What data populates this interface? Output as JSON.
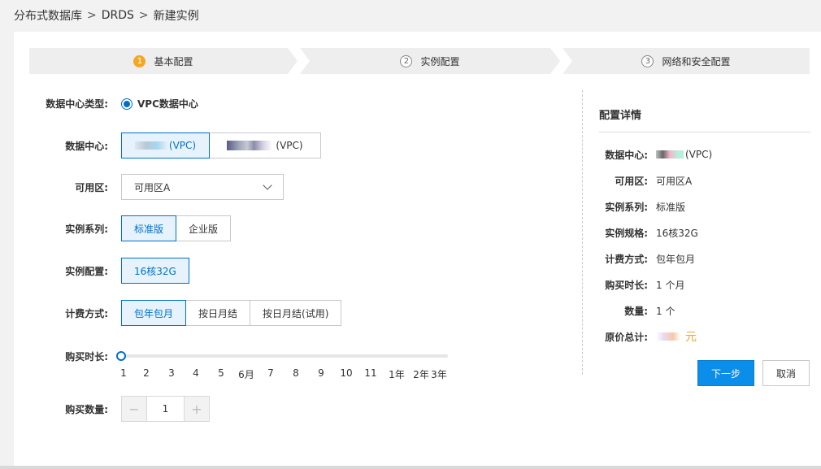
{
  "breadcrumb": {
    "items": [
      "分布式数据库",
      "DRDS",
      "新建实例"
    ],
    "separator": ">"
  },
  "steps": [
    {
      "num": "1",
      "label": "基本配置"
    },
    {
      "num": "2",
      "label": "实例配置"
    },
    {
      "num": "3",
      "label": "网络和安全配置"
    }
  ],
  "form": {
    "datacenter_type": {
      "label": "数据中心类型:",
      "value": "VPC数据中心"
    },
    "datacenter": {
      "label": "数据中心:",
      "options": [
        "(VPC)",
        "(VPC)"
      ]
    },
    "zone": {
      "label": "可用区:",
      "value": "可用区A"
    },
    "series": {
      "label": "实例系列:",
      "options": [
        "标准版",
        "企业版"
      ]
    },
    "config": {
      "label": "实例配置:",
      "options": [
        "16核32G"
      ]
    },
    "billing": {
      "label": "计费方式:",
      "options": [
        "包年包月",
        "按日月结",
        "按日月结(试用)"
      ]
    },
    "duration": {
      "label": "购买时长:",
      "ticks": [
        "1",
        "2",
        "3",
        "4",
        "5",
        "6月",
        "7",
        "8",
        "9",
        "10",
        "11",
        "1年",
        "2年",
        "3年"
      ],
      "selected_index": 0
    },
    "quantity": {
      "label": "购买数量:",
      "value": "1",
      "minus": "−",
      "plus": "+"
    }
  },
  "summary": {
    "title": "配置详情",
    "rows": [
      {
        "k": "数据中心:",
        "v": "(VPC)"
      },
      {
        "k": "可用区:",
        "v": "可用区A"
      },
      {
        "k": "实例系列:",
        "v": "标准版"
      },
      {
        "k": "实例规格:",
        "v": "16核32G"
      },
      {
        "k": "计费方式:",
        "v": "包年包月"
      },
      {
        "k": "购买时长:",
        "v": "1 个月"
      },
      {
        "k": "数量:",
        "v": "1 个"
      },
      {
        "k": "原价总计:",
        "v": "元"
      }
    ]
  },
  "actions": {
    "next": "下一步",
    "cancel": "取消"
  },
  "colors": {
    "accent": "#0070cc",
    "primary_button": "#0a8ee9",
    "step_active": "#f5a623",
    "price": "#f5a623"
  }
}
